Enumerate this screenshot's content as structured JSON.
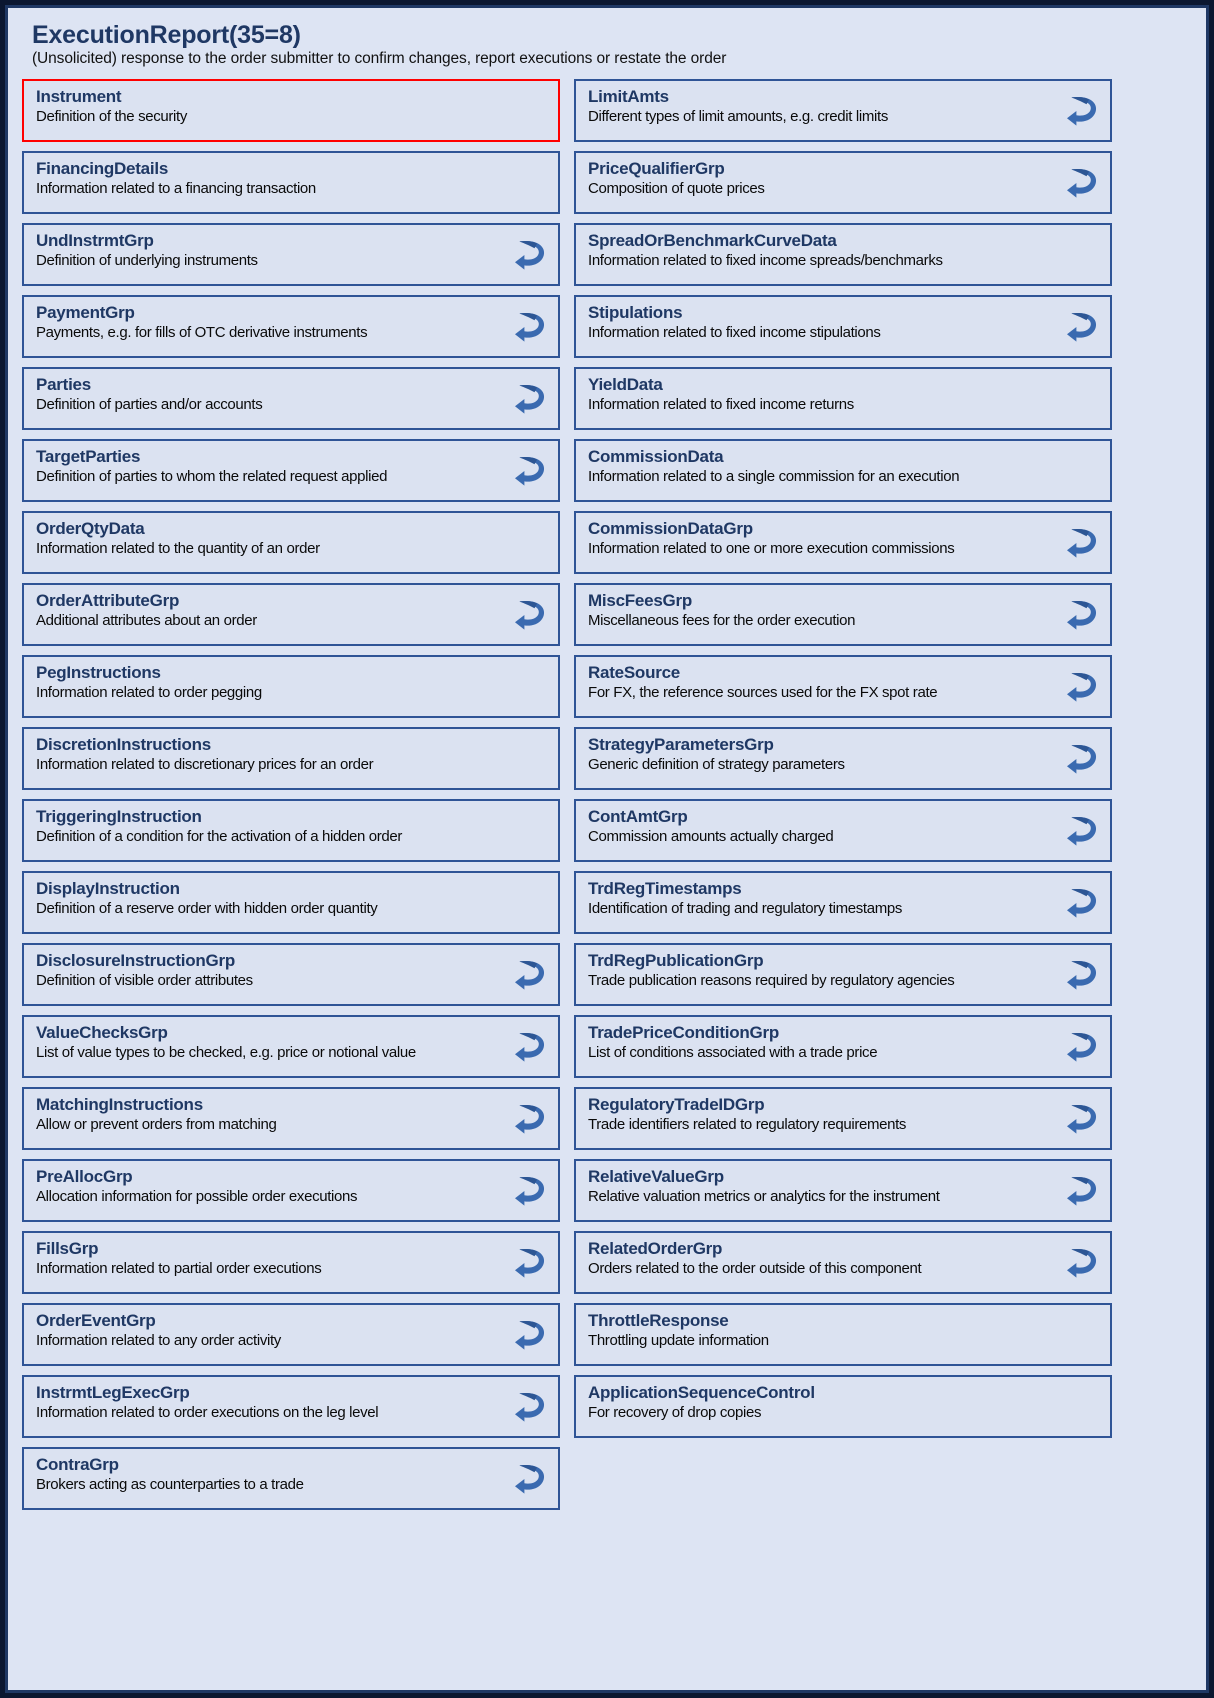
{
  "header": {
    "title": "ExecutionReport(35=8)",
    "subtitle": "(Unsolicited) response to the order submitter to confirm changes, report executions or restate the order"
  },
  "colors": {
    "panel_background": "#dde4f3",
    "panel_border": "#1f3864",
    "box_background": "#dbe2f1",
    "box_border": "#2f5496",
    "name_text": "#1f3864",
    "desc_text": "#0a0a0a",
    "highlight_border": "#ff0000",
    "icon_fill": "#3a6ab0",
    "outer_background": "#0b1730"
  },
  "icons": {
    "repeat": "repeat-loop-arrow-icon"
  },
  "left_column": [
    {
      "name": "Instrument",
      "desc": "Definition of the security",
      "repeat": false,
      "highlight": true
    },
    {
      "name": "FinancingDetails",
      "desc": "Information related to a financing transaction",
      "repeat": false,
      "highlight": false
    },
    {
      "name": "UndInstrmtGrp",
      "desc": "Definition of underlying instruments",
      "repeat": true,
      "highlight": false
    },
    {
      "name": "PaymentGrp",
      "desc": "Payments, e.g. for fills of OTC derivative instruments",
      "repeat": true,
      "highlight": false
    },
    {
      "name": "Parties",
      "desc": "Definition of parties and/or accounts",
      "repeat": true,
      "highlight": false
    },
    {
      "name": "TargetParties",
      "desc": "Definition of parties to whom the related request applied",
      "repeat": true,
      "highlight": false
    },
    {
      "name": "OrderQtyData",
      "desc": "Information related to the quantity of an order",
      "repeat": false,
      "highlight": false
    },
    {
      "name": "OrderAttributeGrp",
      "desc": "Additional attributes about an order",
      "repeat": true,
      "highlight": false
    },
    {
      "name": "PegInstructions",
      "desc": "Information related to order pegging",
      "repeat": false,
      "highlight": false
    },
    {
      "name": "DiscretionInstructions",
      "desc": "Information related to discretionary prices for an order",
      "repeat": false,
      "highlight": false
    },
    {
      "name": "TriggeringInstruction",
      "desc": "Definition of a condition for the activation of a hidden order",
      "repeat": false,
      "highlight": false
    },
    {
      "name": "DisplayInstruction",
      "desc": "Definition of a reserve order with hidden order quantity",
      "repeat": false,
      "highlight": false
    },
    {
      "name": "DisclosureInstructionGrp",
      "desc": "Definition of visible order attributes",
      "repeat": true,
      "highlight": false
    },
    {
      "name": "ValueChecksGrp",
      "desc": "List of value types to be checked, e.g. price or notional value",
      "repeat": true,
      "highlight": false
    },
    {
      "name": "MatchingInstructions",
      "desc": "Allow or prevent orders from matching",
      "repeat": true,
      "highlight": false
    },
    {
      "name": "PreAllocGrp",
      "desc": "Allocation information for possible order executions",
      "repeat": true,
      "highlight": false
    },
    {
      "name": "FillsGrp",
      "desc": "Information related to partial order executions",
      "repeat": true,
      "highlight": false
    },
    {
      "name": "OrderEventGrp",
      "desc": "Information related to any order activity",
      "repeat": true,
      "highlight": false
    },
    {
      "name": "InstrmtLegExecGrp",
      "desc": "Information related to order executions on the leg level",
      "repeat": true,
      "highlight": false
    },
    {
      "name": "ContraGrp",
      "desc": "Brokers acting as counterparties to a trade",
      "repeat": true,
      "highlight": false
    }
  ],
  "right_column": [
    {
      "name": "LimitAmts",
      "desc": "Different types of limit amounts, e.g. credit limits",
      "repeat": true,
      "highlight": false
    },
    {
      "name": "PriceQualifierGrp",
      "desc": "Composition of quote prices",
      "repeat": true,
      "highlight": false
    },
    {
      "name": "SpreadOrBenchmarkCurveData",
      "desc": "Information related to fixed income spreads/benchmarks",
      "repeat": false,
      "highlight": false
    },
    {
      "name": "Stipulations",
      "desc": "Information related to fixed income stipulations",
      "repeat": true,
      "highlight": false
    },
    {
      "name": "YieldData",
      "desc": "Information related to fixed income returns",
      "repeat": false,
      "highlight": false
    },
    {
      "name": "CommissionData",
      "desc": "Information related to a single commission for an execution",
      "repeat": false,
      "highlight": false
    },
    {
      "name": "CommissionDataGrp",
      "desc": "Information related to one or more execution commissions",
      "repeat": true,
      "highlight": false
    },
    {
      "name": "MiscFeesGrp",
      "desc": "Miscellaneous fees for the order execution",
      "repeat": true,
      "highlight": false
    },
    {
      "name": "RateSource",
      "desc": "For FX, the reference sources used for the FX spot rate",
      "repeat": true,
      "highlight": false
    },
    {
      "name": "StrategyParametersGrp",
      "desc": "Generic definition of strategy parameters",
      "repeat": true,
      "highlight": false
    },
    {
      "name": "ContAmtGrp",
      "desc": "Commission amounts actually charged",
      "repeat": true,
      "highlight": false
    },
    {
      "name": "TrdRegTimestamps",
      "desc": "Identification of trading and regulatory timestamps",
      "repeat": true,
      "highlight": false
    },
    {
      "name": "TrdRegPublicationGrp",
      "desc": "Trade publication reasons required by regulatory agencies",
      "repeat": true,
      "highlight": false
    },
    {
      "name": "TradePriceConditionGrp",
      "desc": "List of conditions associated with a trade price",
      "repeat": true,
      "highlight": false
    },
    {
      "name": "RegulatoryTradeIDGrp",
      "desc": "Trade identifiers related to regulatory requirements",
      "repeat": true,
      "highlight": false
    },
    {
      "name": "RelativeValueGrp",
      "desc": "Relative valuation metrics or analytics for the instrument",
      "repeat": true,
      "highlight": false
    },
    {
      "name": "RelatedOrderGrp",
      "desc": "Orders related to the order outside of this component",
      "repeat": true,
      "highlight": false
    },
    {
      "name": "ThrottleResponse",
      "desc": "Throttling update information",
      "repeat": false,
      "highlight": false
    },
    {
      "name": "ApplicationSequenceControl",
      "desc": "For recovery of drop copies",
      "repeat": false,
      "highlight": false
    }
  ]
}
